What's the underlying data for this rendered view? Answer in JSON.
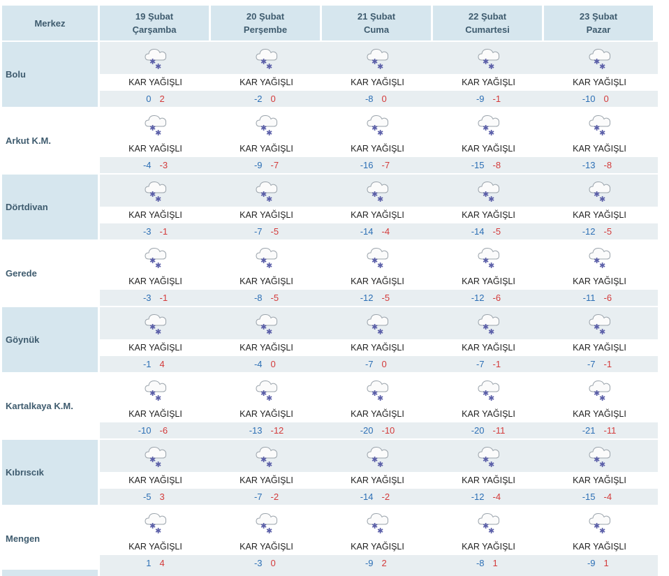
{
  "header": {
    "station_label": "Merkez",
    "days": [
      {
        "date": "19 Şubat",
        "weekday": "Çarşamba"
      },
      {
        "date": "20 Şubat",
        "weekday": "Perşembe"
      },
      {
        "date": "21 Şubat",
        "weekday": "Cuma"
      },
      {
        "date": "22 Şubat",
        "weekday": "Cumartesi"
      },
      {
        "date": "23 Şubat",
        "weekday": "Pazar"
      }
    ]
  },
  "icon_name": "snow-cloud-icon",
  "colors": {
    "header_bg": "#d6e6ee",
    "band_bg": "#e8eef1",
    "min_temp": "#2c6fb5",
    "max_temp": "#d33a3a"
  },
  "stations": [
    {
      "name": "Bolu",
      "days": [
        {
          "condition": "KAR YAĞIŞLI",
          "min": "0",
          "max": "2"
        },
        {
          "condition": "KAR YAĞIŞLI",
          "min": "-2",
          "max": "0"
        },
        {
          "condition": "KAR YAĞIŞLI",
          "min": "-8",
          "max": "0"
        },
        {
          "condition": "KAR YAĞIŞLI",
          "min": "-9",
          "max": "-1"
        },
        {
          "condition": "KAR YAĞIŞLI",
          "min": "-10",
          "max": "0"
        }
      ]
    },
    {
      "name": "Arkut K.M.",
      "days": [
        {
          "condition": "KAR YAĞIŞLI",
          "min": "-4",
          "max": "-3"
        },
        {
          "condition": "KAR YAĞIŞLI",
          "min": "-9",
          "max": "-7"
        },
        {
          "condition": "KAR YAĞIŞLI",
          "min": "-16",
          "max": "-7"
        },
        {
          "condition": "KAR YAĞIŞLI",
          "min": "-15",
          "max": "-8"
        },
        {
          "condition": "KAR YAĞIŞLI",
          "min": "-13",
          "max": "-8"
        }
      ]
    },
    {
      "name": "Dörtdivan",
      "days": [
        {
          "condition": "KAR YAĞIŞLI",
          "min": "-3",
          "max": "-1"
        },
        {
          "condition": "KAR YAĞIŞLI",
          "min": "-7",
          "max": "-5"
        },
        {
          "condition": "KAR YAĞIŞLI",
          "min": "-14",
          "max": "-4"
        },
        {
          "condition": "KAR YAĞIŞLI",
          "min": "-14",
          "max": "-5"
        },
        {
          "condition": "KAR YAĞIŞLI",
          "min": "-12",
          "max": "-5"
        }
      ]
    },
    {
      "name": "Gerede",
      "days": [
        {
          "condition": "KAR YAĞIŞLI",
          "min": "-3",
          "max": "-1"
        },
        {
          "condition": "KAR YAĞIŞLI",
          "min": "-8",
          "max": "-5"
        },
        {
          "condition": "KAR YAĞIŞLI",
          "min": "-12",
          "max": "-5"
        },
        {
          "condition": "KAR YAĞIŞLI",
          "min": "-12",
          "max": "-6"
        },
        {
          "condition": "KAR YAĞIŞLI",
          "min": "-11",
          "max": "-6"
        }
      ]
    },
    {
      "name": "Göynük",
      "days": [
        {
          "condition": "KAR YAĞIŞLI",
          "min": "-1",
          "max": "4"
        },
        {
          "condition": "KAR YAĞIŞLI",
          "min": "-4",
          "max": "0"
        },
        {
          "condition": "KAR YAĞIŞLI",
          "min": "-7",
          "max": "0"
        },
        {
          "condition": "KAR YAĞIŞLI",
          "min": "-7",
          "max": "-1"
        },
        {
          "condition": "KAR YAĞIŞLI",
          "min": "-7",
          "max": "-1"
        }
      ]
    },
    {
      "name": "Kartalkaya K.M.",
      "days": [
        {
          "condition": "KAR YAĞIŞLI",
          "min": "-10",
          "max": "-6"
        },
        {
          "condition": "KAR YAĞIŞLI",
          "min": "-13",
          "max": "-12"
        },
        {
          "condition": "KAR YAĞIŞLI",
          "min": "-20",
          "max": "-10"
        },
        {
          "condition": "KAR YAĞIŞLI",
          "min": "-20",
          "max": "-11"
        },
        {
          "condition": "KAR YAĞIŞLI",
          "min": "-21",
          "max": "-11"
        }
      ]
    },
    {
      "name": "Kıbrıscık",
      "days": [
        {
          "condition": "KAR YAĞIŞLI",
          "min": "-5",
          "max": "3"
        },
        {
          "condition": "KAR YAĞIŞLI",
          "min": "-7",
          "max": "-2"
        },
        {
          "condition": "KAR YAĞIŞLI",
          "min": "-14",
          "max": "-2"
        },
        {
          "condition": "KAR YAĞIŞLI",
          "min": "-12",
          "max": "-4"
        },
        {
          "condition": "KAR YAĞIŞLI",
          "min": "-15",
          "max": "-4"
        }
      ]
    },
    {
      "name": "Mengen",
      "days": [
        {
          "condition": "KAR YAĞIŞLI",
          "min": "1",
          "max": "4"
        },
        {
          "condition": "KAR YAĞIŞLI",
          "min": "-3",
          "max": "0"
        },
        {
          "condition": "KAR YAĞIŞLI",
          "min": "-9",
          "max": "2"
        },
        {
          "condition": "KAR YAĞIŞLI",
          "min": "-8",
          "max": "1"
        },
        {
          "condition": "KAR YAĞIŞLI",
          "min": "-9",
          "max": "1"
        }
      ]
    }
  ]
}
